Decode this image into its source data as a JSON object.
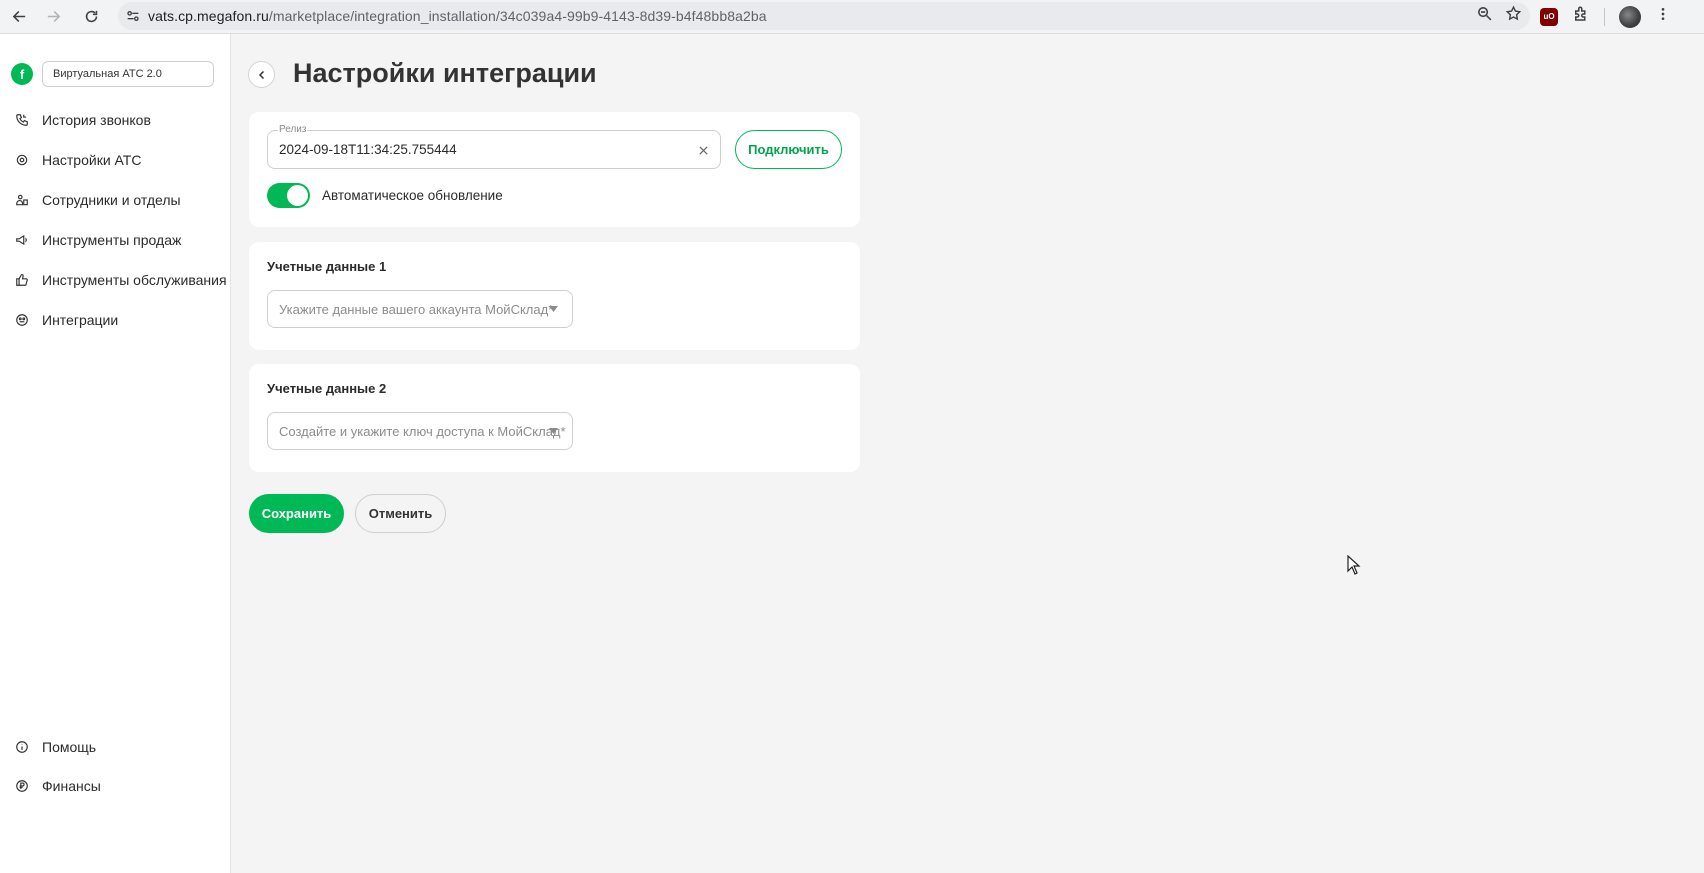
{
  "browser": {
    "url_host": "vats.cp.megafon.ru",
    "url_path": "/marketplace/integration_installation/34c039a4-99b9-4143-8d39-b4f48bb8a2ba",
    "ublock_badge": "uO"
  },
  "sidebar": {
    "logo_glyph": "f",
    "product": "Виртуальная АТС 2.0",
    "items": [
      {
        "label": "История звонков",
        "icon": "phone-history-icon"
      },
      {
        "label": "Настройки АТС",
        "icon": "gear-icon"
      },
      {
        "label": "Сотрудники и отделы",
        "icon": "people-icon"
      },
      {
        "label": "Инструменты продаж",
        "icon": "megaphone-icon"
      },
      {
        "label": "Инструменты обслуживания",
        "icon": "thumbs-up-icon"
      },
      {
        "label": "Интеграции",
        "icon": "integrations-icon"
      }
    ],
    "bottom_items": [
      {
        "label": "Помощь",
        "icon": "info-icon"
      },
      {
        "label": "Финансы",
        "icon": "ruble-icon"
      }
    ]
  },
  "main": {
    "title": "Настройки интеграции",
    "release": {
      "label": "Релиз",
      "value": "2024-09-18T11:34:25.755444"
    },
    "connect_label": "Подключить",
    "auto_update": {
      "label": "Автоматическое обновление",
      "enabled": true
    },
    "credentials1": {
      "title": "Учетные данные 1",
      "placeholder": "Укажите данные вашего аккаунта МойСклад",
      "required_mark": "*"
    },
    "credentials2": {
      "title": "Учетные данные 2",
      "placeholder": "Создайте и укажите ключ доступа к МойСклад",
      "required_mark": "*"
    },
    "save_label": "Сохранить",
    "cancel_label": "Отменить"
  },
  "colors": {
    "accent": "#00b956",
    "page_bg": "#f4f4f4"
  }
}
